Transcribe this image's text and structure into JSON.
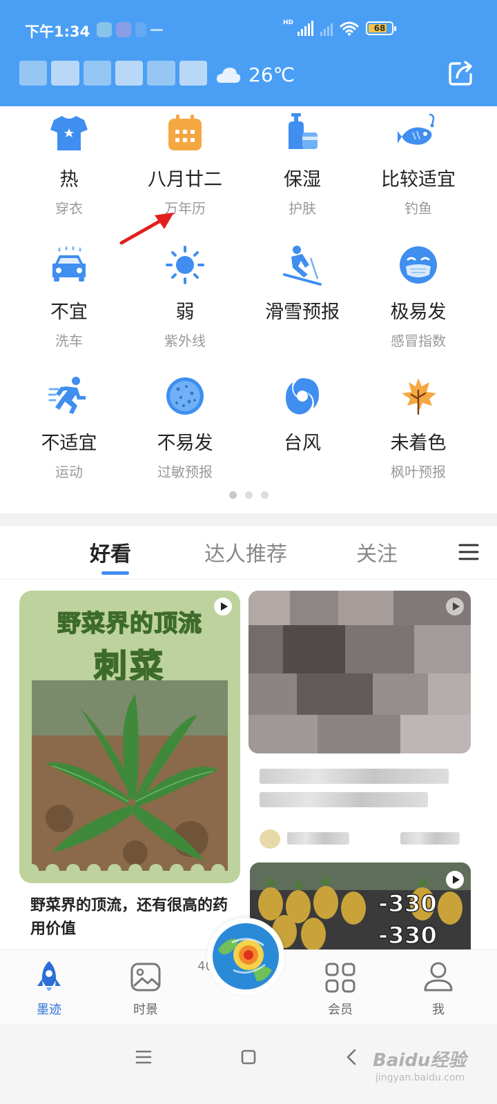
{
  "status_bar": {
    "time": "下午1:34",
    "network_label": "HD",
    "battery_level": "68"
  },
  "header": {
    "temperature": "26℃",
    "weather_icon": "cloud-icon",
    "action_icon": "share-icon"
  },
  "tools": [
    {
      "value": "热",
      "label": "穿衣",
      "icon": "tshirt-icon"
    },
    {
      "value": "八月廿二",
      "label": "万年历",
      "icon": "calendar-icon"
    },
    {
      "value": "保湿",
      "label": "护肤",
      "icon": "skincare-bottle-icon"
    },
    {
      "value": "比较适宜",
      "label": "钓鱼",
      "icon": "fish-icon"
    },
    {
      "value": "不宜",
      "label": "洗车",
      "icon": "car-wash-icon"
    },
    {
      "value": "弱",
      "label": "紫外线",
      "icon": "sun-icon"
    },
    {
      "value": "滑雪预报",
      "label": "",
      "icon": "skier-icon"
    },
    {
      "value": "极易发",
      "label": "感冒指数",
      "icon": "mask-face-icon"
    },
    {
      "value": "不适宜",
      "label": "运动",
      "icon": "runner-icon"
    },
    {
      "value": "不易发",
      "label": "过敏预报",
      "icon": "pollen-icon"
    },
    {
      "value": "台风",
      "label": "",
      "icon": "typhoon-icon"
    },
    {
      "value": "未着色",
      "label": "枫叶预报",
      "icon": "maple-leaf-icon"
    }
  ],
  "pager": {
    "current": 1,
    "total": 3
  },
  "feed_tabs": [
    "好看",
    "达人推荐",
    "关注"
  ],
  "feed": {
    "card1": {
      "title": "野菜界的顶流",
      "subtitle": "刺菜",
      "caption": "野菜界的顶流，还有很高的药用价值"
    },
    "card3": {
      "price1": "-330",
      "price2": "-330"
    }
  },
  "bottom_nav": [
    {
      "label": "墨迹",
      "icon": "rocket-icon",
      "active": true
    },
    {
      "label": "时景",
      "icon": "picture-icon",
      "active": false
    },
    {
      "label": "会员",
      "icon": "grid-icon",
      "active": false
    },
    {
      "label": "我",
      "icon": "user-icon",
      "active": false
    }
  ],
  "center_stub": "40",
  "watermark": {
    "text": "Baidu经验",
    "sub": "jingyan.baidu.com"
  },
  "colors": {
    "header_bg": "#4a9ff5",
    "accent": "#3f8ef0",
    "active_nav": "#2b6fd6"
  }
}
